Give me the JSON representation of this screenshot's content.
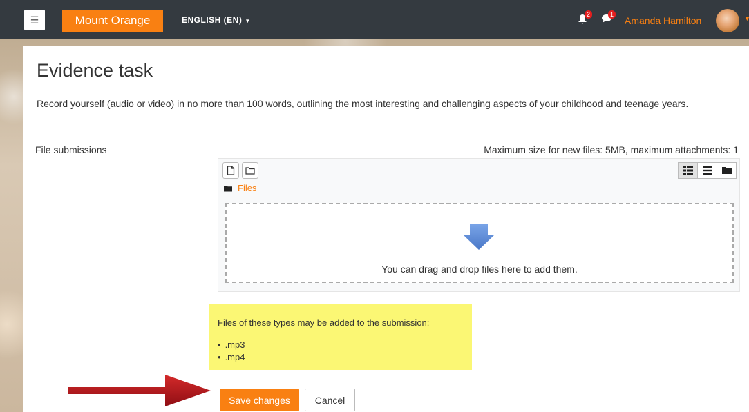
{
  "nav": {
    "menu_icon": "hamburger-icon",
    "brand": "Mount Orange",
    "language": "ENGLISH (EN)",
    "notifications_count": "2",
    "messages_count": "1",
    "user_name": "Amanda Hamilton"
  },
  "page": {
    "title": "Evidence task",
    "intro": "Record yourself (audio or video) in no more than 100 words, outlining the most interesting and challenging aspects of your childhood and teenage years."
  },
  "submission": {
    "field_label": "File submissions",
    "max_size": "Maximum size for new files: 5MB, maximum attachments: 1",
    "path_label": "Files",
    "drop_text": "You can drag and drop files here to add them."
  },
  "file_types": {
    "heading": "Files of these types may be added to the submission:",
    "types": [
      ".mp3",
      ".mp4"
    ]
  },
  "actions": {
    "save": "Save changes",
    "cancel": "Cancel"
  },
  "colors": {
    "accent": "#f98012",
    "navbar": "#343a40",
    "highlight": "#fbf774",
    "arrow": "#b5121b",
    "drop_arrow": "#5b8fd8"
  }
}
